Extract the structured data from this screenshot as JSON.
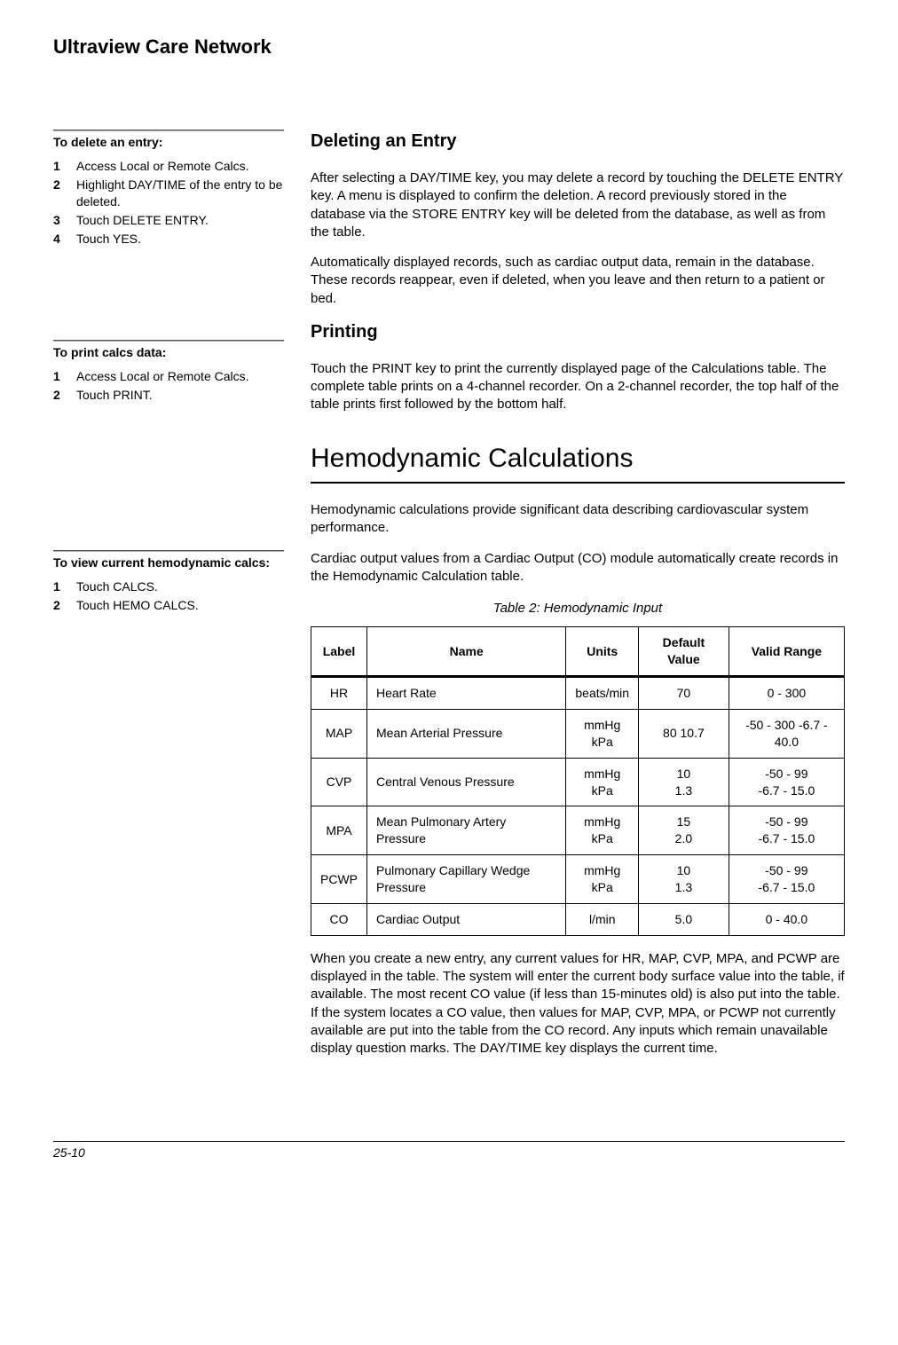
{
  "header": {
    "title": "Ultraview Care Network"
  },
  "footer": {
    "page": "25-10"
  },
  "sidebar": {
    "delete": {
      "title": "To delete an entry:",
      "items": [
        "Access Local or Remote Calcs.",
        "Highlight DAY/TIME of the entry to be deleted.",
        "Touch DELETE ENTRY.",
        "Touch YES."
      ]
    },
    "print": {
      "title": "To print calcs data:",
      "items": [
        "Access Local or Remote Calcs.",
        "Touch PRINT."
      ]
    },
    "hemo": {
      "title": "To view current hemodynamic calcs:",
      "items": [
        "Touch CALCS.",
        "Touch HEMO CALCS."
      ]
    }
  },
  "main": {
    "deleting": {
      "heading": "Deleting an Entry",
      "p1": "After selecting a DAY/TIME key, you may delete a record by touching the DELETE ENTRY key. A menu is displayed to confirm the deletion. A record previously stored in the database via the STORE ENTRY key will be deleted from the database, as well as from the table.",
      "p2": "Automatically displayed records, such as cardiac output data, remain in the database. These records reappear, even if deleted, when you leave and then return to a patient or bed."
    },
    "printing": {
      "heading": "Printing",
      "p1": "Touch the PRINT key to print the currently displayed page of the Calculations table. The complete table prints on a 4-channel recorder. On a 2-channel recorder, the top half of the table prints first followed by the bottom half."
    },
    "hemo": {
      "heading": "Hemodynamic Calculations",
      "p1": "Hemodynamic calculations provide significant data describing cardiovascular system performance.",
      "p2": "Cardiac output values from a Cardiac Output (CO) module automatically create records in the Hemodynamic Calculation table.",
      "table_caption": "Table 2: Hemodynamic Input",
      "table": {
        "headers": [
          "Label",
          "Name",
          "Units",
          "Default Value",
          "Valid Range"
        ],
        "rows": [
          {
            "label": "HR",
            "name": "Heart Rate",
            "units": "beats/min",
            "default": "70",
            "range": "0 - 300"
          },
          {
            "label": "MAP",
            "name": "Mean Arterial Pressure",
            "units": "mmHg\nkPa",
            "default": "80 10.7",
            "range": "-50 - 300 -6.7 - 40.0"
          },
          {
            "label": "CVP",
            "name": "Central Venous Pressure",
            "units": "mmHg\nkPa",
            "default": "10\n1.3",
            "range": "-50 - 99\n-6.7 - 15.0"
          },
          {
            "label": "MPA",
            "name": "Mean Pulmonary Artery Pressure",
            "units": "mmHg\nkPa",
            "default": "15\n2.0",
            "range": "-50 - 99\n-6.7 - 15.0"
          },
          {
            "label": "PCWP",
            "name": "Pulmonary Capillary Wedge Pressure",
            "units": "mmHg\nkPa",
            "default": "10\n1.3",
            "range": "-50 - 99\n-6.7 - 15.0"
          },
          {
            "label": "CO",
            "name": "Cardiac Output",
            "units": "l/min",
            "default": "5.0",
            "range": "0 - 40.0"
          }
        ]
      },
      "p3": "When you create a new entry, any current values for HR, MAP, CVP, MPA, and PCWP are displayed in the table. The system will enter the current body surface value into the table, if available. The most recent CO value (if less than 15-minutes old) is also put into the table. If the system locates a CO value, then values for MAP, CVP, MPA, or PCWP not currently available are put into the table from the CO record. Any inputs which remain unavailable display question marks. The DAY/TIME key displays the current time."
    }
  }
}
